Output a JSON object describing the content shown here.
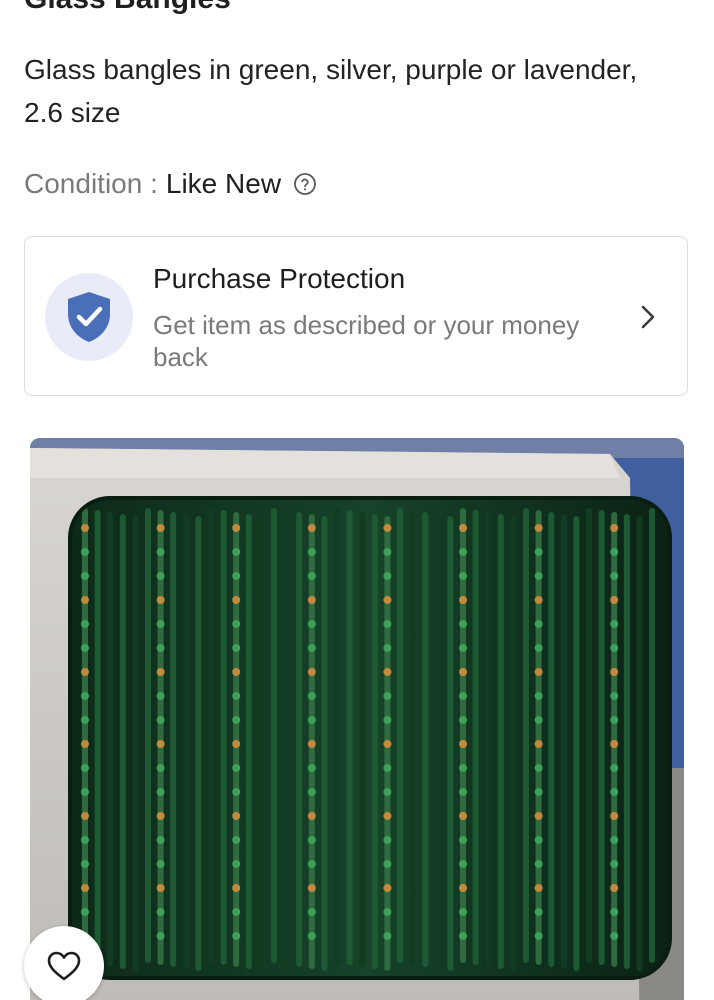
{
  "product": {
    "title": "Glass Bangles",
    "description": "Glass bangles in green, silver, purple or lavender, 2.6 size",
    "condition_label": "Condition :",
    "condition_value": "Like New"
  },
  "protection": {
    "title": "Purchase Protection",
    "subtitle": "Get item as described or your money back"
  },
  "icons": {
    "help": "question-circle-icon",
    "shield": "shield-check-icon",
    "chevron": "chevron-right-icon",
    "favorite": "heart-icon"
  },
  "colors": {
    "accent": "#4a6fb8",
    "shield_bg": "#e9ecf8",
    "muted_text": "#7a7a7a"
  }
}
